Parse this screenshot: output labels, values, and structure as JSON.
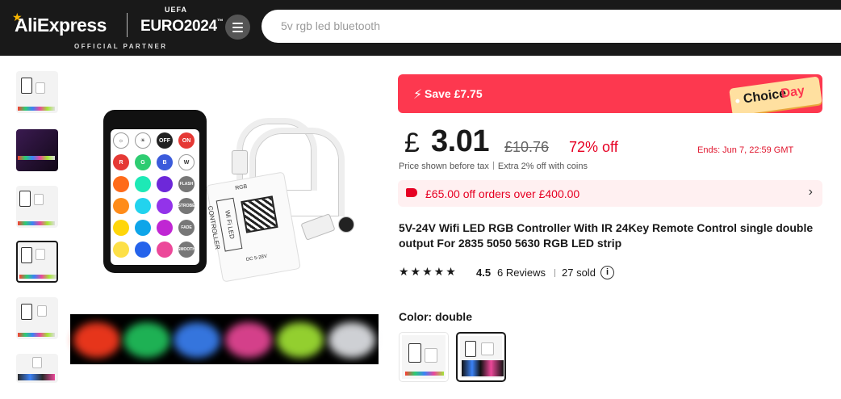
{
  "header": {
    "brand": "AliExpress",
    "sponsor_small": "UEFA",
    "sponsor": "EURO2024",
    "sponsor_tm": "™",
    "partner_label": "OFFICIAL PARTNER",
    "search_placeholder": "5v rgb led bluetooth"
  },
  "gallery": {
    "thumbnails": [
      "thumb-1",
      "thumb-2",
      "thumb-3",
      "thumb-4",
      "thumb-5",
      "thumb-6"
    ],
    "active_index": 3
  },
  "remote": {
    "row1": [
      "☼",
      "☀",
      "OFF",
      "ON"
    ],
    "row2": [
      "R",
      "G",
      "B",
      "W"
    ],
    "side": [
      "FLASH",
      "STROBE",
      "FADE",
      "SMOOTH"
    ]
  },
  "controller": {
    "label": "Wi Fi LED CONTROLLER",
    "spec": "DC 5-28V",
    "rgb": "RGB"
  },
  "promo": {
    "save_text": "Save £7.75",
    "badge_part1": "Choice",
    "badge_part2": "Day"
  },
  "price": {
    "currency": "£",
    "current": "3.01",
    "original": "£10.76",
    "discount": "72% off",
    "ends": "Ends: Jun 7, 22:59 GMT",
    "tax_note": "Price shown before tax",
    "extra": "Extra 2% off with coins"
  },
  "coupon": {
    "text": "£65.00 off orders over £400.00",
    "arrow": "›"
  },
  "product": {
    "title": "5V-24V Wifi LED RGB Controller With IR 24Key Remote Control single double output For 2835 5050 5630 RGB LED strip",
    "stars": "★★★★★",
    "score": "4.5",
    "reviews": "6 Reviews",
    "sold": "27 sold",
    "info": "i"
  },
  "variants": {
    "label": "Color: double",
    "options": [
      "single",
      "double"
    ],
    "selected": "double"
  },
  "colors": {
    "brand_red": "#fd384f",
    "price_red": "#e60023",
    "header_bg": "#191919"
  }
}
